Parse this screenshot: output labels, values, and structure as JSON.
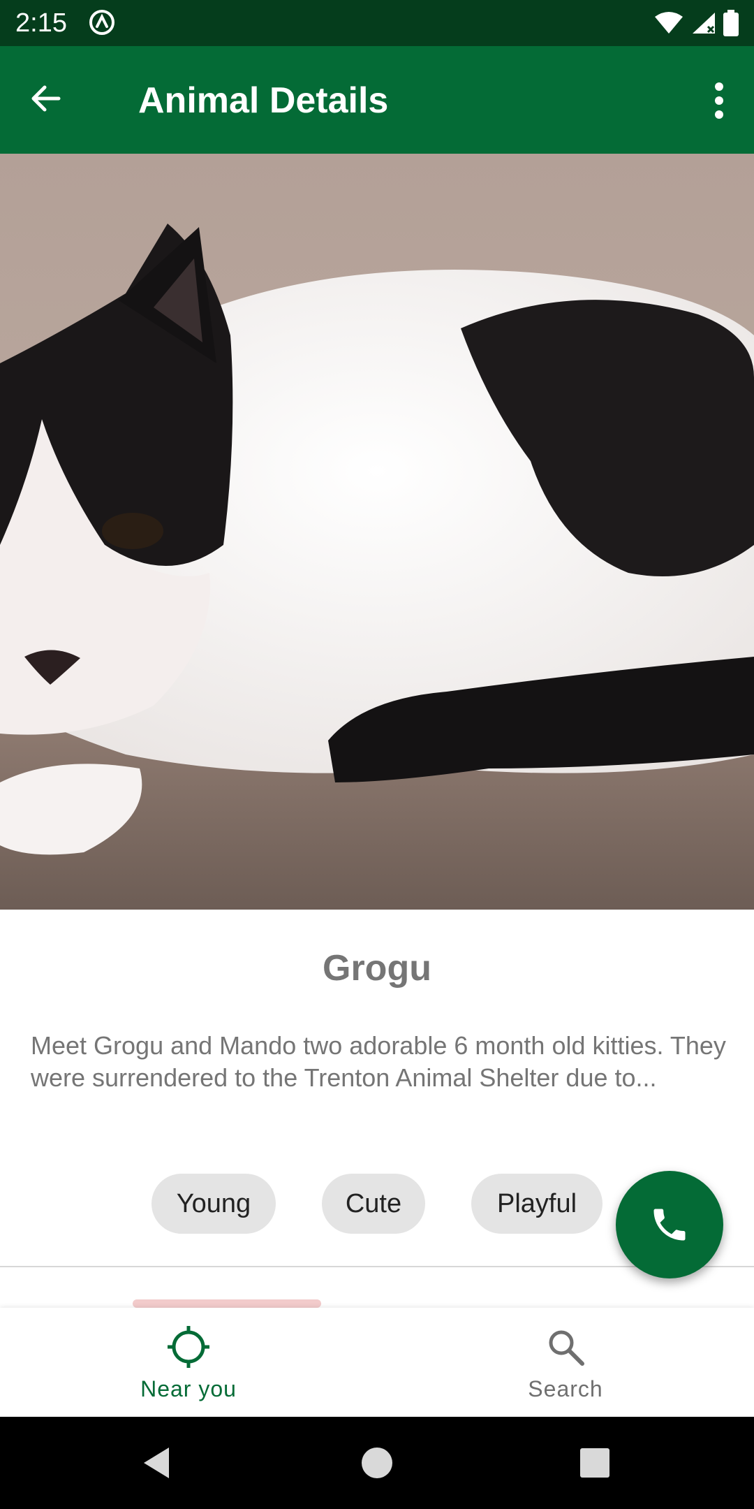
{
  "status_bar": {
    "time": "2:15",
    "icons": [
      "sync-icon",
      "wifi-icon",
      "signal-icon",
      "battery-icon"
    ]
  },
  "app_bar": {
    "title": "Animal Details",
    "back_icon": "arrow-back-icon",
    "menu_icon": "more-vert-icon"
  },
  "animal": {
    "name": "Grogu",
    "description": "Meet Grogu and Mando two adorable 6 month old kitties. They were surrendered to the Trenton Animal Shelter due to...",
    "tags": [
      "Young",
      "Cute",
      "Playful"
    ],
    "photo_alt": "black-and-white-cat-photo"
  },
  "fab": {
    "icon": "phone-icon"
  },
  "bottom_nav": {
    "items": [
      {
        "label": "Near you",
        "icon": "location-crosshair-icon",
        "active": true
      },
      {
        "label": "Search",
        "icon": "search-icon",
        "active": false
      }
    ]
  },
  "system_nav": {
    "buttons": [
      "back-triangle-icon",
      "home-circle-icon",
      "recents-square-icon"
    ]
  },
  "colors": {
    "status_bar": "#053d1c",
    "primary": "#046b36",
    "chip_bg": "#e4e4e4",
    "text_muted": "#757575"
  }
}
